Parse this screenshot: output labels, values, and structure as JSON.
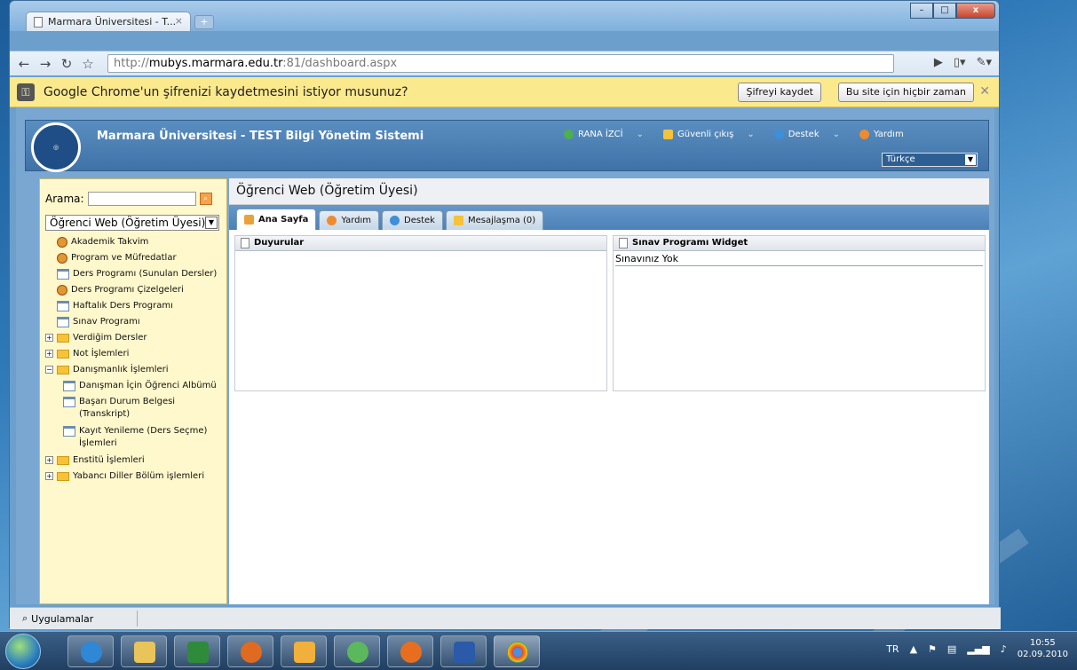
{
  "browser": {
    "tab_title": "Marmara Üniversitesi - T...",
    "url_prefix": "http://",
    "url_host": "mubys.marmara.edu.tr",
    "url_rest": ":81/dashboard.aspx",
    "infobar_text": "Google Chrome'un şifrenizi kaydetmesini istiyor musunuz?",
    "save_password_label": "Şifreyi kaydet",
    "never_label": "Bu site için hiçbir zaman"
  },
  "app": {
    "logo_text": "MARMARA ÜNİVERSİTESİ 1883",
    "title": "Marmara Üniversitesi - TEST Bilgi Yönetim Sistemi",
    "user_name": "RANA İZCİ",
    "logout_label": "Güvenli çıkış",
    "support_label": "Destek",
    "help_label": "Yardım",
    "language": "Türkçe"
  },
  "sidebar": {
    "search_label": "Arama:",
    "search_value": "",
    "role_selected": "Öğrenci Web (Öğretim Üyesi)",
    "tree": [
      {
        "label": "Akademik Takvim",
        "icon": "compass-icon",
        "expander": ""
      },
      {
        "label": "Program ve Müfredatlar",
        "icon": "compass-icon",
        "expander": ""
      },
      {
        "label": "Ders Programı (Sunulan Dersler)",
        "icon": "calendar-icon",
        "expander": ""
      },
      {
        "label": "Ders Programı Çizelgeleri",
        "icon": "compass-icon",
        "expander": ""
      },
      {
        "label": "Haftalık Ders Programı",
        "icon": "calendar-icon",
        "expander": ""
      },
      {
        "label": "Sınav Programı",
        "icon": "calendar-icon",
        "expander": ""
      },
      {
        "label": "Verdiğim Dersler",
        "icon": "folder-icon",
        "expander": "+"
      },
      {
        "label": "Not İşlemleri",
        "icon": "folder-icon",
        "expander": "+"
      },
      {
        "label": "Danışmanlık İşlemleri",
        "icon": "folder-icon",
        "expander": "−"
      },
      {
        "label": "Danışman İçin Öğrenci Albümü",
        "icon": "calendar-icon",
        "expander": ""
      },
      {
        "label": "Başarı Durum Belgesi (Transkript)",
        "icon": "calendar-icon",
        "expander": ""
      },
      {
        "label": "Kayıt Yenileme (Ders Seçme) İşlemleri",
        "icon": "calendar-icon",
        "expander": ""
      },
      {
        "label": "Enstitü İşlemleri",
        "icon": "folder-icon",
        "expander": "+"
      },
      {
        "label": "Yabancı Diller Bölüm işlemleri",
        "icon": "folder-icon",
        "expander": "+"
      }
    ]
  },
  "main": {
    "title": "Öğrenci Web (Öğretim Üyesi)",
    "tabs": [
      {
        "label": "Ana Sayfa",
        "icon": "home-icon"
      },
      {
        "label": "Yardım",
        "icon": "help-icon"
      },
      {
        "label": "Destek",
        "icon": "info-icon"
      },
      {
        "label": "Mesajlaşma (0)",
        "icon": "mail-icon"
      }
    ],
    "widgets": [
      {
        "title": "Duyurular",
        "body": ""
      },
      {
        "title": "Sınav Programı Widget",
        "body": "Sınavınız Yok"
      }
    ]
  },
  "statusbar": {
    "apps_label": "Uygulamalar"
  },
  "taskbar": {
    "language": "TR",
    "time": "10:55",
    "date": "02.09.2010"
  },
  "colors": {
    "accent": "#4c81b8",
    "sidebar_bg": "#fff8cc",
    "infobar_bg": "#fbe98d"
  }
}
